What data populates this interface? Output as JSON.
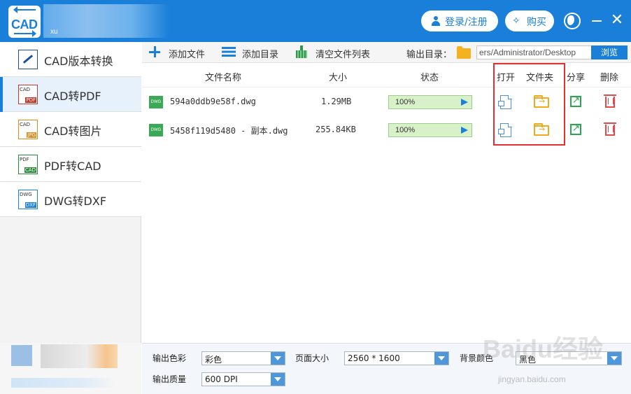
{
  "app": {
    "title_suffix": "xu",
    "logo_text": "CAD",
    "login_label": "登录/注册",
    "buy_label": "购买"
  },
  "sidebar": {
    "items": [
      {
        "label": "CAD版本转换",
        "icon": "cad-version-icon",
        "icon_text": "",
        "icon_text2": ""
      },
      {
        "label": "CAD转PDF",
        "icon": "cad-to-pdf-icon",
        "icon_text": "CAD",
        "icon_text2": "PDF"
      },
      {
        "label": "CAD转图片",
        "icon": "cad-to-image-icon",
        "icon_text": "CAD",
        "icon_text2": "JPG"
      },
      {
        "label": "PDF转CAD",
        "icon": "pdf-to-cad-icon",
        "icon_text": "PDF",
        "icon_text2": "CAD"
      },
      {
        "label": "DWG转DXF",
        "icon": "dwg-to-dxf-icon",
        "icon_text": "DWG",
        "icon_text2": "DXF"
      }
    ],
    "active_index": 1
  },
  "toolbar": {
    "add_file": "添加文件",
    "add_dir": "添加目录",
    "clear_list": "清空文件列表",
    "output_dir_label": "输出目录：",
    "output_path": "ers/Administrator/Desktop",
    "browse": "浏览"
  },
  "table": {
    "headers": {
      "name": "文件名称",
      "size": "大小",
      "status": "状态",
      "open": "打开",
      "folder": "文件夹",
      "share": "分享",
      "delete": "删除"
    },
    "rows": [
      {
        "icon_text": "DWG",
        "name": "594a0ddb9e58f.dwg",
        "size": "1.29MB",
        "progress_text": "100%",
        "progress": 1.0
      },
      {
        "icon_text": "DWG",
        "name": "5458f119d5480 - 副本.dwg",
        "size": "255.84KB",
        "progress_text": "100%",
        "progress": 1.0
      }
    ]
  },
  "options": {
    "color_label": "输出色彩",
    "color_value": "彩色",
    "page_size_label": "页面大小",
    "page_size_value": "2560 * 1600",
    "bg_color_label": "背景颜色",
    "bg_color_value": "黑色",
    "quality_label": "输出质量",
    "quality_value": "600 DPI"
  },
  "watermark": {
    "text": "Baidu经验",
    "sub": "jingyan.baidu.com"
  },
  "colors": {
    "accent": "#1a7fd8",
    "highlight_box": "#e03030",
    "progress_fill": "#d8f1c8"
  }
}
